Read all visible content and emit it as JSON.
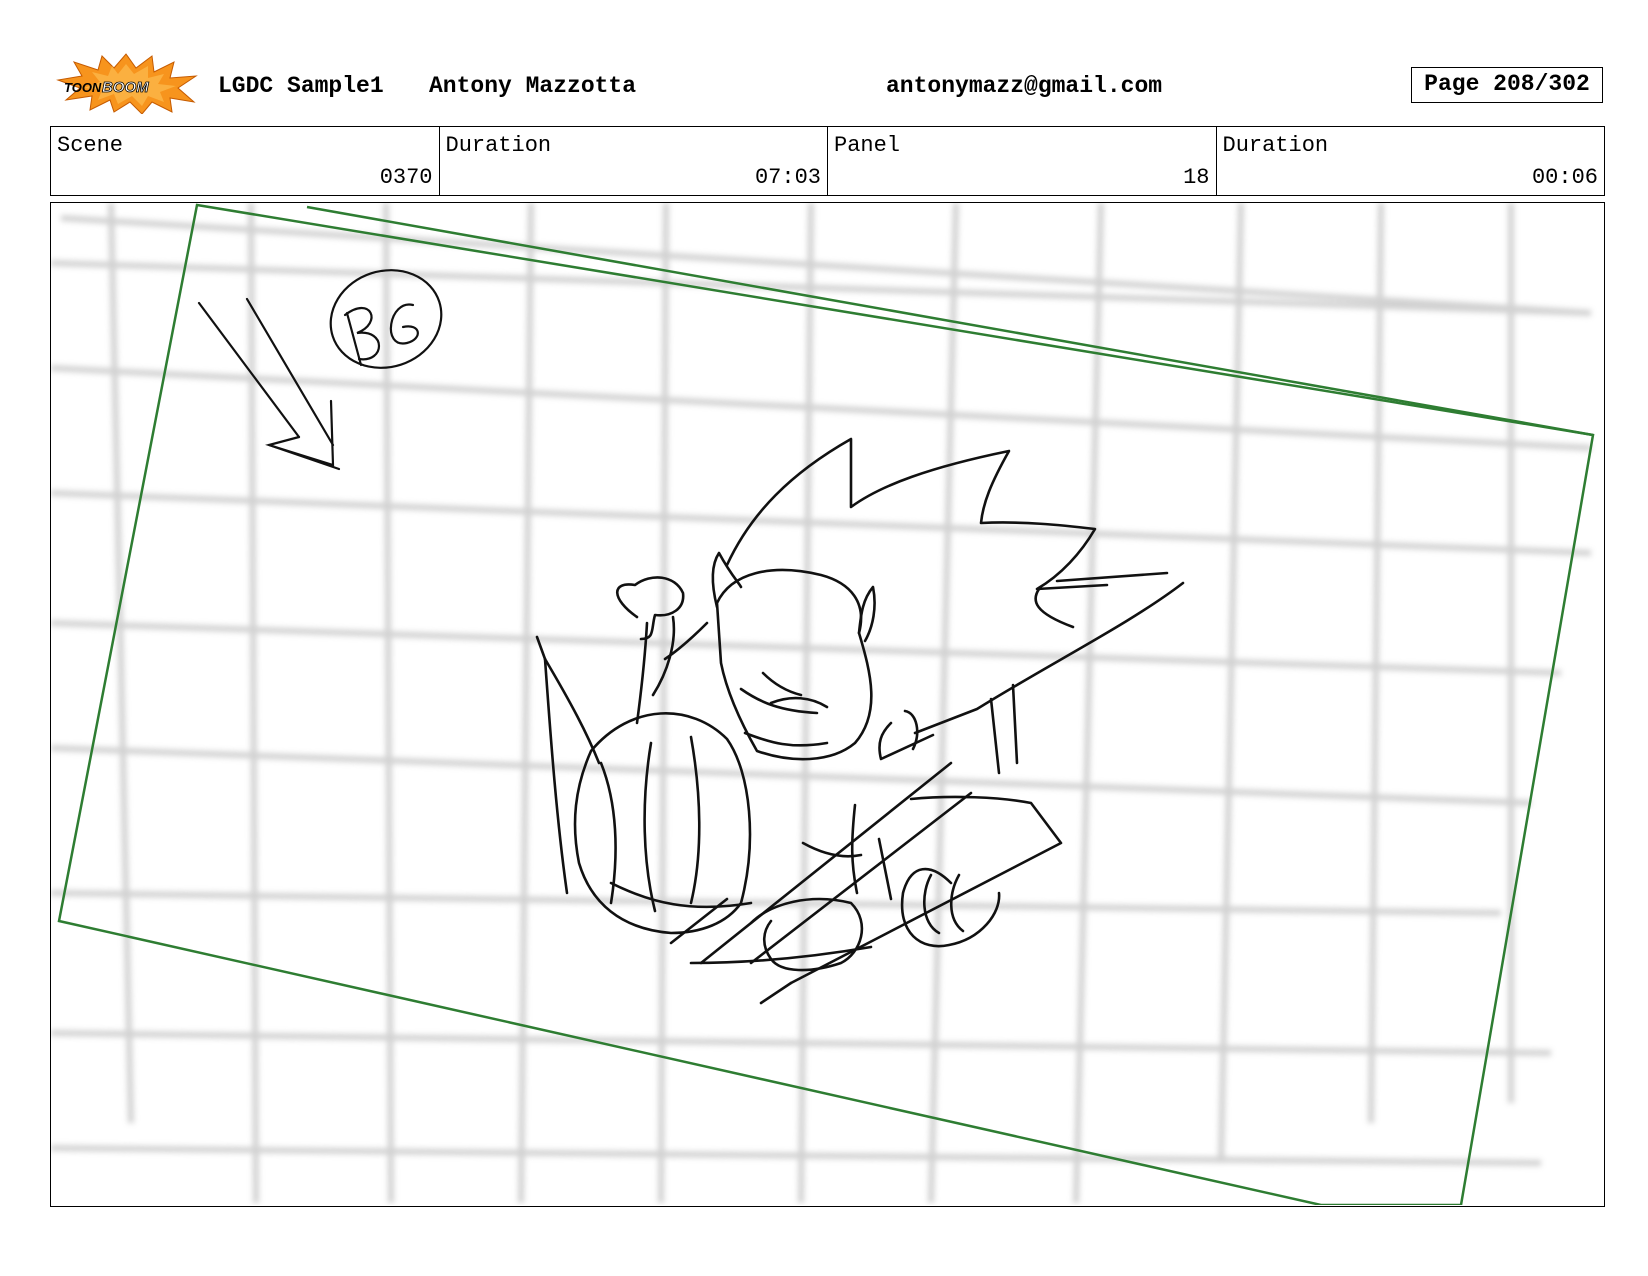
{
  "header": {
    "logo": {
      "text_top": "TOON",
      "text_bottom": "BOOM",
      "icon": "toon-boom-burst-logo",
      "burst_color": "#f7941d",
      "burst_inner_color": "#fbb040"
    },
    "project": "LGDC Sample1",
    "author": "Antony Mazzotta",
    "email": "antonymazz@gmail.com",
    "page": "Page 208/302"
  },
  "info": {
    "scene_label": "Scene",
    "scene_value": "0370",
    "scene_duration_label": "Duration",
    "scene_duration_value": "07:03",
    "panel_label": "Panel",
    "panel_value": "18",
    "panel_duration_label": "Duration",
    "panel_duration_value": "00:06"
  },
  "panel": {
    "frame_color": "#2e7d32",
    "annotation_icon": "arrow-down-right-icon",
    "annotation_text": "BG"
  }
}
